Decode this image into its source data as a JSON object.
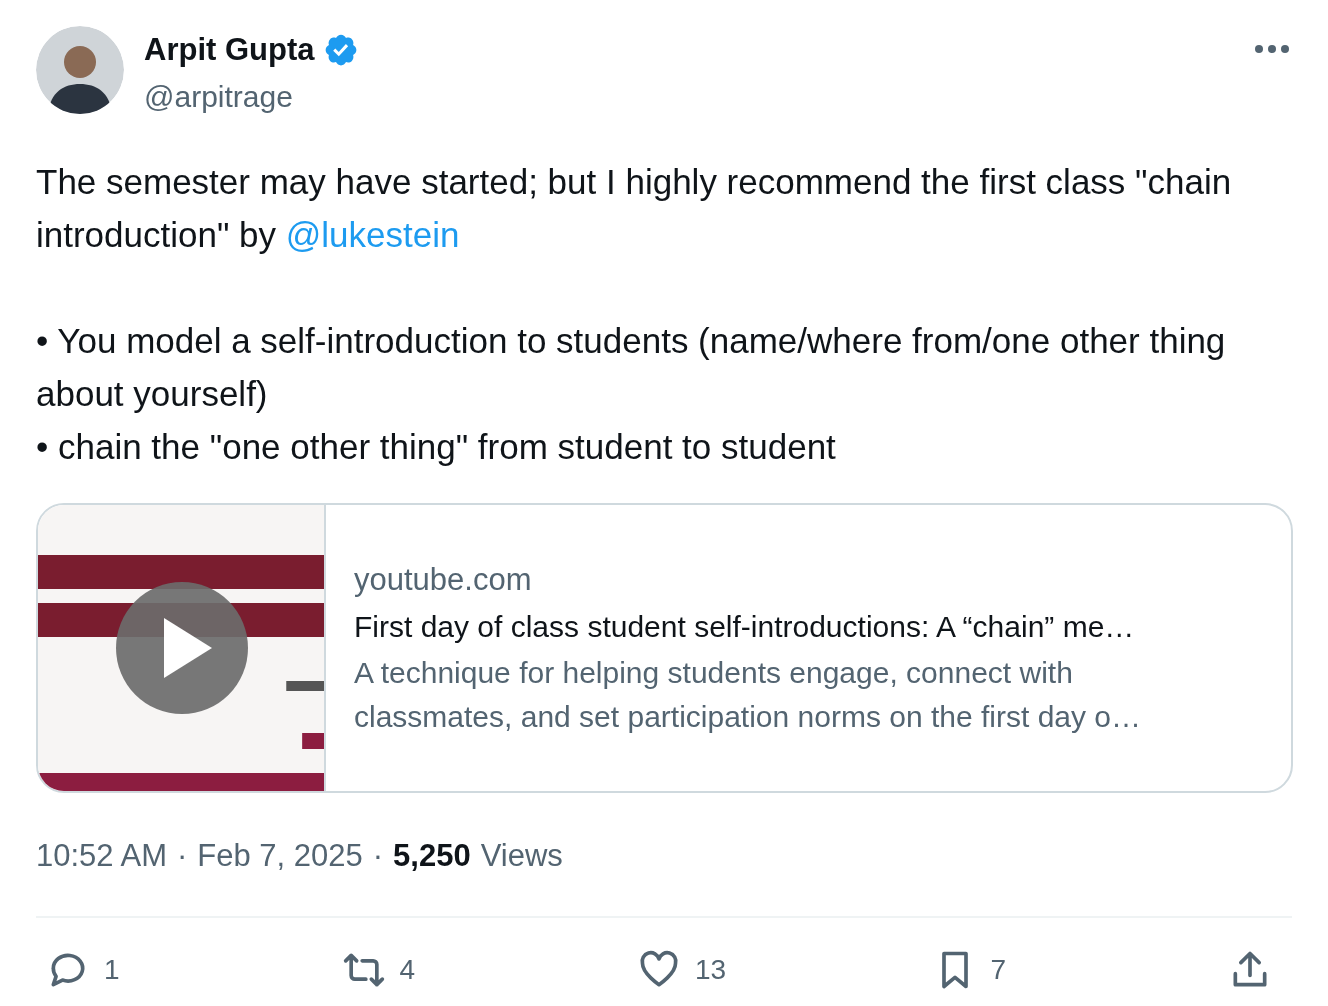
{
  "author": {
    "name": "Arpit Gupta",
    "verified": true,
    "handle": "@arpitrage"
  },
  "paragraphs": [
    {
      "text": "The semester may have started; but I highly recommend the first class \"chain introduction\" by ",
      "mention": "@lukestein"
    },
    {
      "text": "• You model a self-introduction to students (name/where from/one other thing about yourself)"
    },
    {
      "text": "• chain the \"one other thing\" from student to student"
    }
  ],
  "card": {
    "kind": "picture",
    "domain": "youtube.com",
    "title": "First day of class student self-introductions: A “chain” me…",
    "description": "A technique for helping students engage, connect with classmates, and set participation norms on the first day o…"
  },
  "meta": {
    "time": "10:52 AM",
    "separator": "·",
    "date": "Feb 7, 2025",
    "separator_2": "·",
    "views_count": "5,250",
    "views_label": "Views"
  },
  "actions": [
    {
      "kind": "reply",
      "count": "1"
    },
    {
      "kind": "repost",
      "count": "4"
    },
    {
      "kind": "like",
      "count": "13"
    },
    {
      "kind": "bookmark",
      "count": "7"
    },
    {
      "kind": "share"
    }
  ]
}
